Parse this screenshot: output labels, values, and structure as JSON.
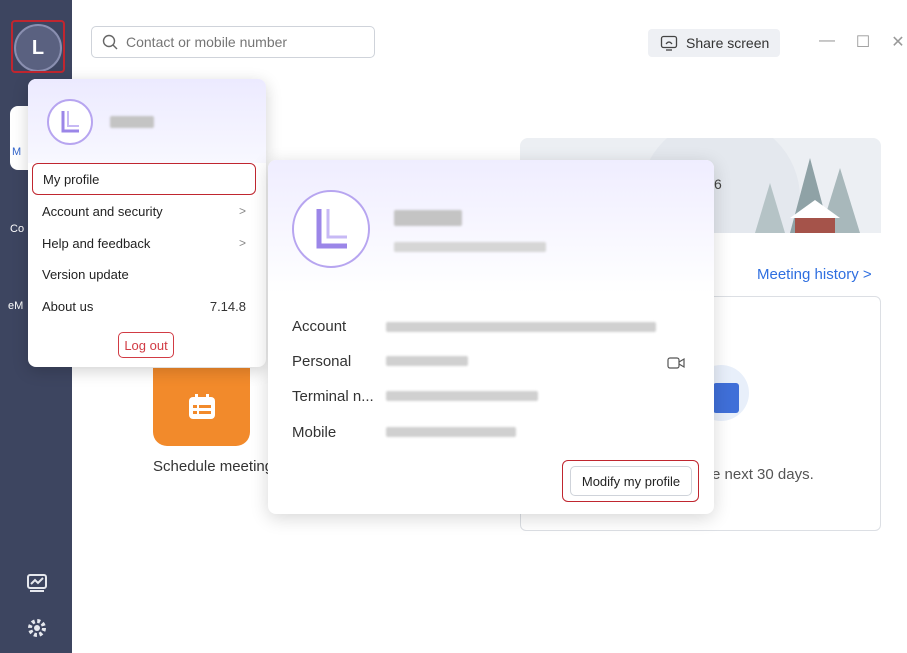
{
  "search": {
    "placeholder": "Contact or mobile number"
  },
  "topbar": {
    "share_label": "Share screen",
    "minimize_glyph": "—",
    "maximize_glyph": "☐",
    "close_glyph": "✕"
  },
  "rail": {
    "avatar_letter": "L",
    "items": [
      {
        "label": "M"
      },
      {
        "label": "Co"
      },
      {
        "label": "eM"
      }
    ]
  },
  "menu": {
    "items": [
      {
        "label": "My profile",
        "extra": ""
      },
      {
        "label": "Account and security",
        "extra": ">"
      },
      {
        "label": "Help and feedback",
        "extra": ">"
      },
      {
        "label": "Version update",
        "extra": ""
      },
      {
        "label": "About us",
        "extra": "7.14.8"
      }
    ],
    "logout_label": "Log out"
  },
  "profile_card": {
    "fields": [
      {
        "label": "Account"
      },
      {
        "label": "Personal"
      },
      {
        "label": "Terminal n..."
      },
      {
        "label": "Mobile"
      }
    ],
    "modify_label": "Modify my profile"
  },
  "background": {
    "banner_date": "6",
    "history_label": "Meeting history",
    "history_chevron": ">",
    "next30_text": "e next 30 days.",
    "schedule_label": "Schedule meeting"
  },
  "colors": {
    "rail": "#3d4560",
    "accent": "#2f6fe0",
    "highlight": "#c0262f",
    "schedule_tile": "#f28a2b"
  }
}
